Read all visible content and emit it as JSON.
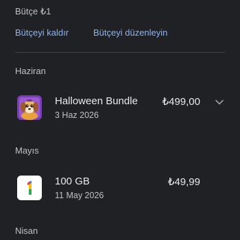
{
  "budget": {
    "label": "Bütçe ₺1"
  },
  "actions": {
    "remove": "Bütçeyi kaldır",
    "edit": "Bütçeyi düzenleyin"
  },
  "sections": [
    {
      "month": "Haziran",
      "item": {
        "title": "Halloween Bundle",
        "date": "3 Haz 2026",
        "price": "₺499,00",
        "icon": "dog-character-icon",
        "expandable": true
      }
    },
    {
      "month": "Mayıs",
      "item": {
        "title": "100 GB",
        "date": "11 May 2026",
        "price": "₺49,99",
        "icon": "google-one-icon",
        "expandable": false
      }
    },
    {
      "month": "Nisan"
    }
  ],
  "colors": {
    "background": "#202124",
    "accent": "#8ab4f8",
    "text": "#e8eaed",
    "muted": "#bdc1c6",
    "divider": "#3c4043"
  }
}
